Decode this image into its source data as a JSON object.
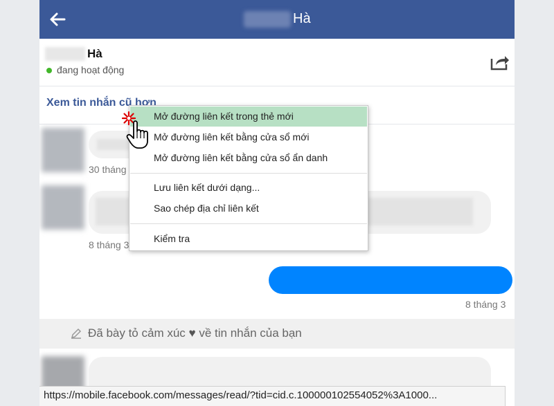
{
  "header": {
    "title": "Hà",
    "back_icon": "arrow-left-icon"
  },
  "profile": {
    "name": "Hà",
    "status": "đang hoạt động",
    "status_color": "#42b72a",
    "share_icon": "share-icon"
  },
  "thread": {
    "older_messages_link": "Xem tin nhắn cũ hơn",
    "messages": [
      {
        "time": "30 tháng"
      },
      {
        "time": "8 tháng 3"
      },
      {
        "time": "8 tháng 3"
      }
    ],
    "reaction_notice": {
      "prefix": "Đã bày tỏ cảm xúc",
      "heart": "♥",
      "suffix": "về tin nhắn của bạn"
    }
  },
  "context_menu": {
    "items": [
      {
        "label": "Mở đường liên kết trong thẻ mới"
      },
      {
        "label": "Mở đường liên kết bằng cửa sổ mới"
      },
      {
        "label": "Mở đường liên kết bằng cửa sổ ẩn danh"
      },
      {
        "label": "Lưu liên kết dưới dạng..."
      },
      {
        "label": "Sao chép địa chỉ liên kết"
      },
      {
        "label": "Kiểm tra"
      }
    ]
  },
  "status_bar": {
    "url": "https://mobile.facebook.com/messages/read/?tid=cid.c.100000102554052%3A1000..."
  },
  "colors": {
    "header_bg": "#3b5998",
    "link": "#3b5998",
    "sent_bubble": "#0084ff",
    "menu_highlight": "#b7e0c4"
  }
}
